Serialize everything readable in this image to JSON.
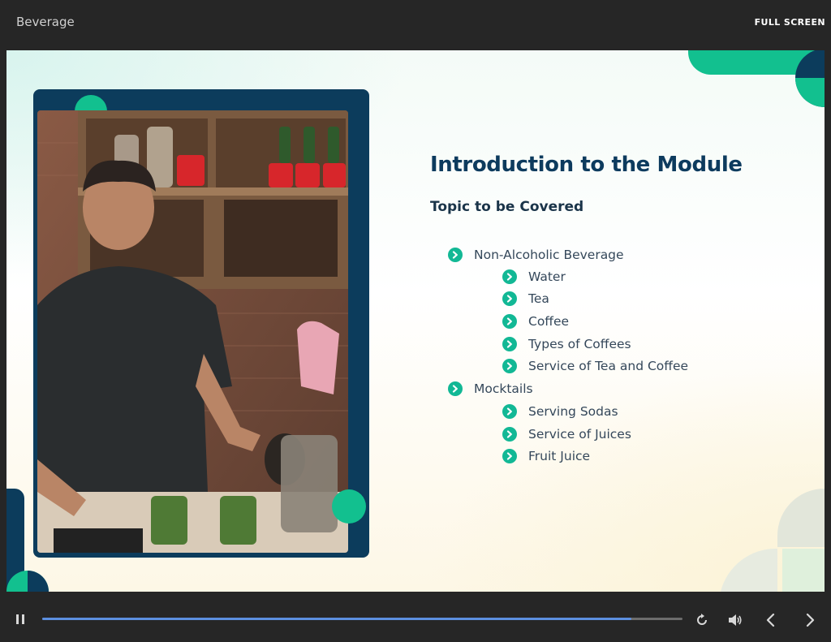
{
  "window": {
    "title": "Beverage",
    "fullscreen_label": "FULL SCREEN"
  },
  "slide": {
    "heading": "Introduction to the Module",
    "subheading": "Topic to be Covered",
    "topics": [
      {
        "label": "Non-Alcoholic Beverage",
        "subtopics": [
          "Water",
          "Tea",
          "Coffee",
          "Types of Coffees",
          "Service of Tea and Coffee"
        ]
      },
      {
        "label": "Mocktails",
        "subtopics": [
          "Serving Sodas",
          "Service of Juices",
          "Fruit Juice"
        ]
      }
    ]
  },
  "player": {
    "progress_fraction": 0.92
  },
  "colors": {
    "accent": "#12b895",
    "navy": "#0d3b5e",
    "chrome": "#262626",
    "progress": "#5c8fe0"
  },
  "icons": [
    "pause-icon",
    "replay-icon",
    "volume-icon",
    "previous-icon",
    "next-icon",
    "chevron-right-icon"
  ]
}
